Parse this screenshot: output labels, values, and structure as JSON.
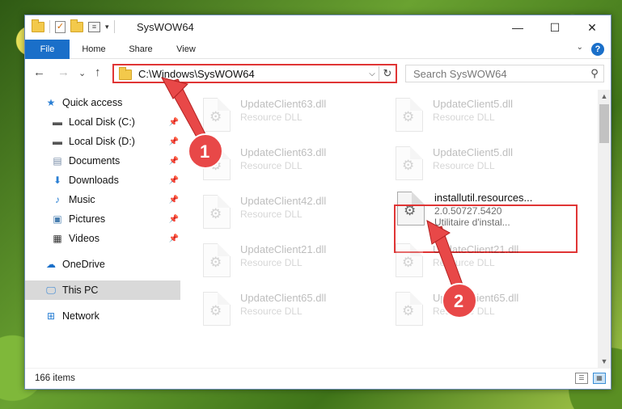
{
  "window": {
    "title": "SysWOW64",
    "controls": {
      "minimize": "—",
      "maximize": "☐",
      "close": "✕"
    }
  },
  "ribbon": {
    "tabs": [
      "File",
      "Home",
      "Share",
      "View"
    ],
    "expand": "⌄",
    "help": "?"
  },
  "navigation": {
    "back": "←",
    "forward": "→",
    "recent": "⌄",
    "up": "↑",
    "address": "C:\\Windows\\SysWOW64",
    "search_placeholder": "Search SysWOW64"
  },
  "sidebar": {
    "items": [
      {
        "label": "Quick access",
        "icon": "star-icon"
      },
      {
        "label": "Local Disk (C:)",
        "icon": "drive-icon",
        "pinned": true
      },
      {
        "label": "Local Disk (D:)",
        "icon": "drive-icon",
        "pinned": true
      },
      {
        "label": "Documents",
        "icon": "documents-icon",
        "pinned": true
      },
      {
        "label": "Downloads",
        "icon": "downloads-icon",
        "pinned": true
      },
      {
        "label": "Music",
        "icon": "music-icon",
        "pinned": true
      },
      {
        "label": "Pictures",
        "icon": "pictures-icon",
        "pinned": true
      },
      {
        "label": "Videos",
        "icon": "videos-icon",
        "pinned": true
      },
      {
        "label": "OneDrive",
        "icon": "onedrive-icon"
      },
      {
        "label": "This PC",
        "icon": "computer-icon",
        "selected": true
      },
      {
        "label": "Network",
        "icon": "network-icon"
      }
    ]
  },
  "files": [
    {
      "name": "UpdateClient63.dll",
      "type": "Resource DLL",
      "faded": true
    },
    {
      "name": "UpdateClient5.dll",
      "type": "Resource DLL",
      "faded": true
    },
    {
      "name": "UpdateClient63.dll",
      "type": "Resource DLL",
      "faded": true
    },
    {
      "name": "UpdateClient5.dll",
      "type": "Resource DLL",
      "faded": true
    },
    {
      "name": "UpdateClient42.dll",
      "type": "Resource DLL",
      "faded": true
    },
    {
      "name": "installutil.resources...",
      "version": "2.0.50727.5420",
      "type": "Utilitaire d'instal...",
      "faded": false
    },
    {
      "name": "UpdateClient21.dll",
      "type": "Resource DLL",
      "faded": true
    },
    {
      "name": "UpdateClient21.dll",
      "type": "Resource DLL",
      "faded": true
    },
    {
      "name": "UpdateClient65.dll",
      "type": "Resource DLL",
      "faded": true
    },
    {
      "name": "UpdateClient65.dll",
      "type": "Resource DLL",
      "faded": true
    }
  ],
  "status": {
    "item_count": "166 items"
  },
  "annotations": {
    "step1": "1",
    "step2": "2"
  },
  "colors": {
    "accent": "#1a6fc9",
    "highlight": "#e03535",
    "selected": "#d9d9d9"
  }
}
